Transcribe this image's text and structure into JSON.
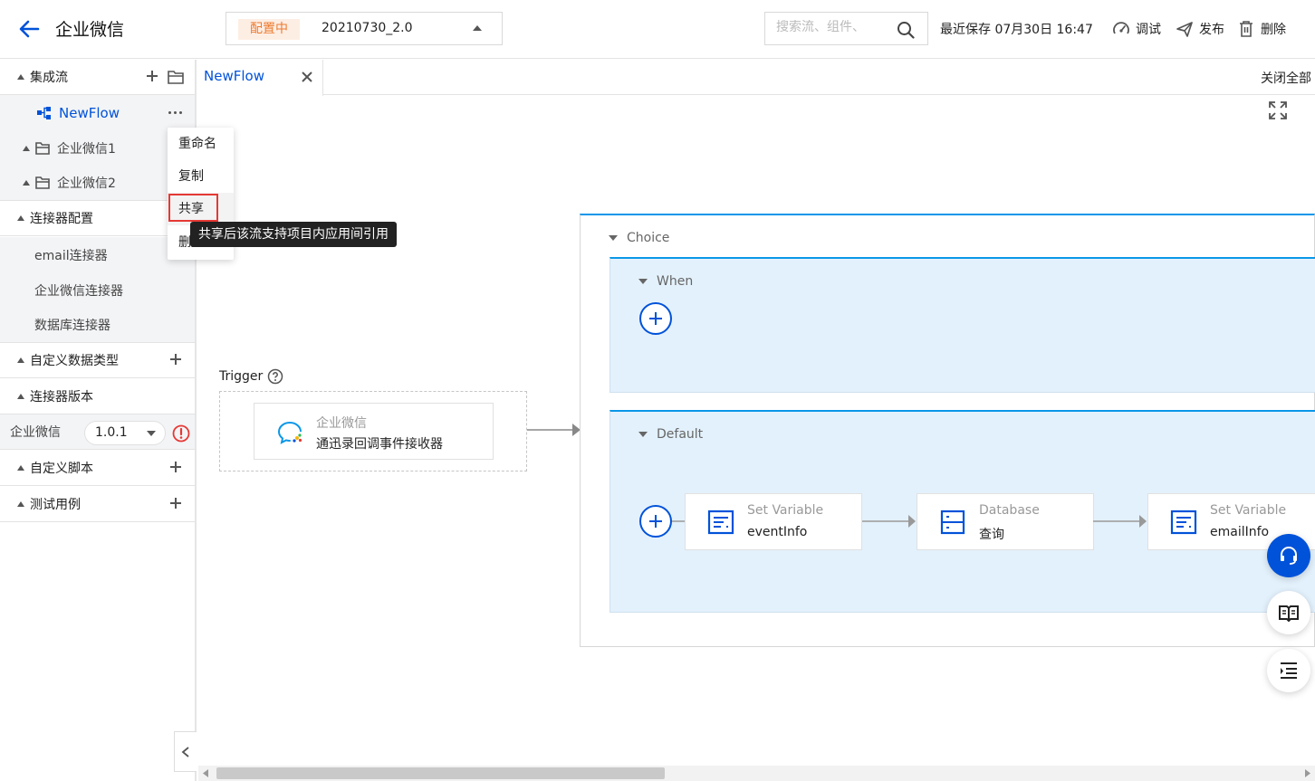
{
  "header": {
    "title": "企业微信",
    "status_tag": "配置中",
    "version": "20210730_2.0",
    "search_placeholder": "搜索流、组件、",
    "save_time": "最近保存 07月30日 16:47",
    "debug_label": "调试",
    "publish_label": "发布",
    "delete_label": "删除"
  },
  "sidebar": {
    "flows_label": "集成流",
    "flow_item": "NewFlow",
    "folder1": "企业微信1",
    "folder2": "企业微信2",
    "connector_config": "连接器配置",
    "connectors": [
      "email连接器",
      "企业微信连接器",
      "数据库连接器"
    ],
    "custom_types": "自定义数据类型",
    "connector_version": "连接器版本",
    "version_row_label": "企业微信",
    "version_value": "1.0.1",
    "custom_scripts": "自定义脚本",
    "test_cases": "测试用例"
  },
  "context_menu": {
    "rename": "重命名",
    "copy": "复制",
    "share": "共享",
    "delete": "删除",
    "tooltip": "共享后该流支持项目内应用间引用"
  },
  "tabs": {
    "active": "NewFlow",
    "close_all": "关闭全部"
  },
  "canvas": {
    "trigger_label": "Trigger",
    "trigger_connector": "企业微信",
    "trigger_name": "通迅录回调事件接收器",
    "choice_label": "Choice",
    "when_label": "When",
    "default_label": "Default",
    "nodes": [
      {
        "type": "Set Variable",
        "name": "eventInfo"
      },
      {
        "type": "Database",
        "name": "查询"
      },
      {
        "type": "Set Variable",
        "name": "emailInfo"
      }
    ]
  },
  "colors": {
    "accent": "#0052d9",
    "panel": "#e3f1fc",
    "border_accent": "#0a97e8",
    "warn": "#e53935"
  }
}
